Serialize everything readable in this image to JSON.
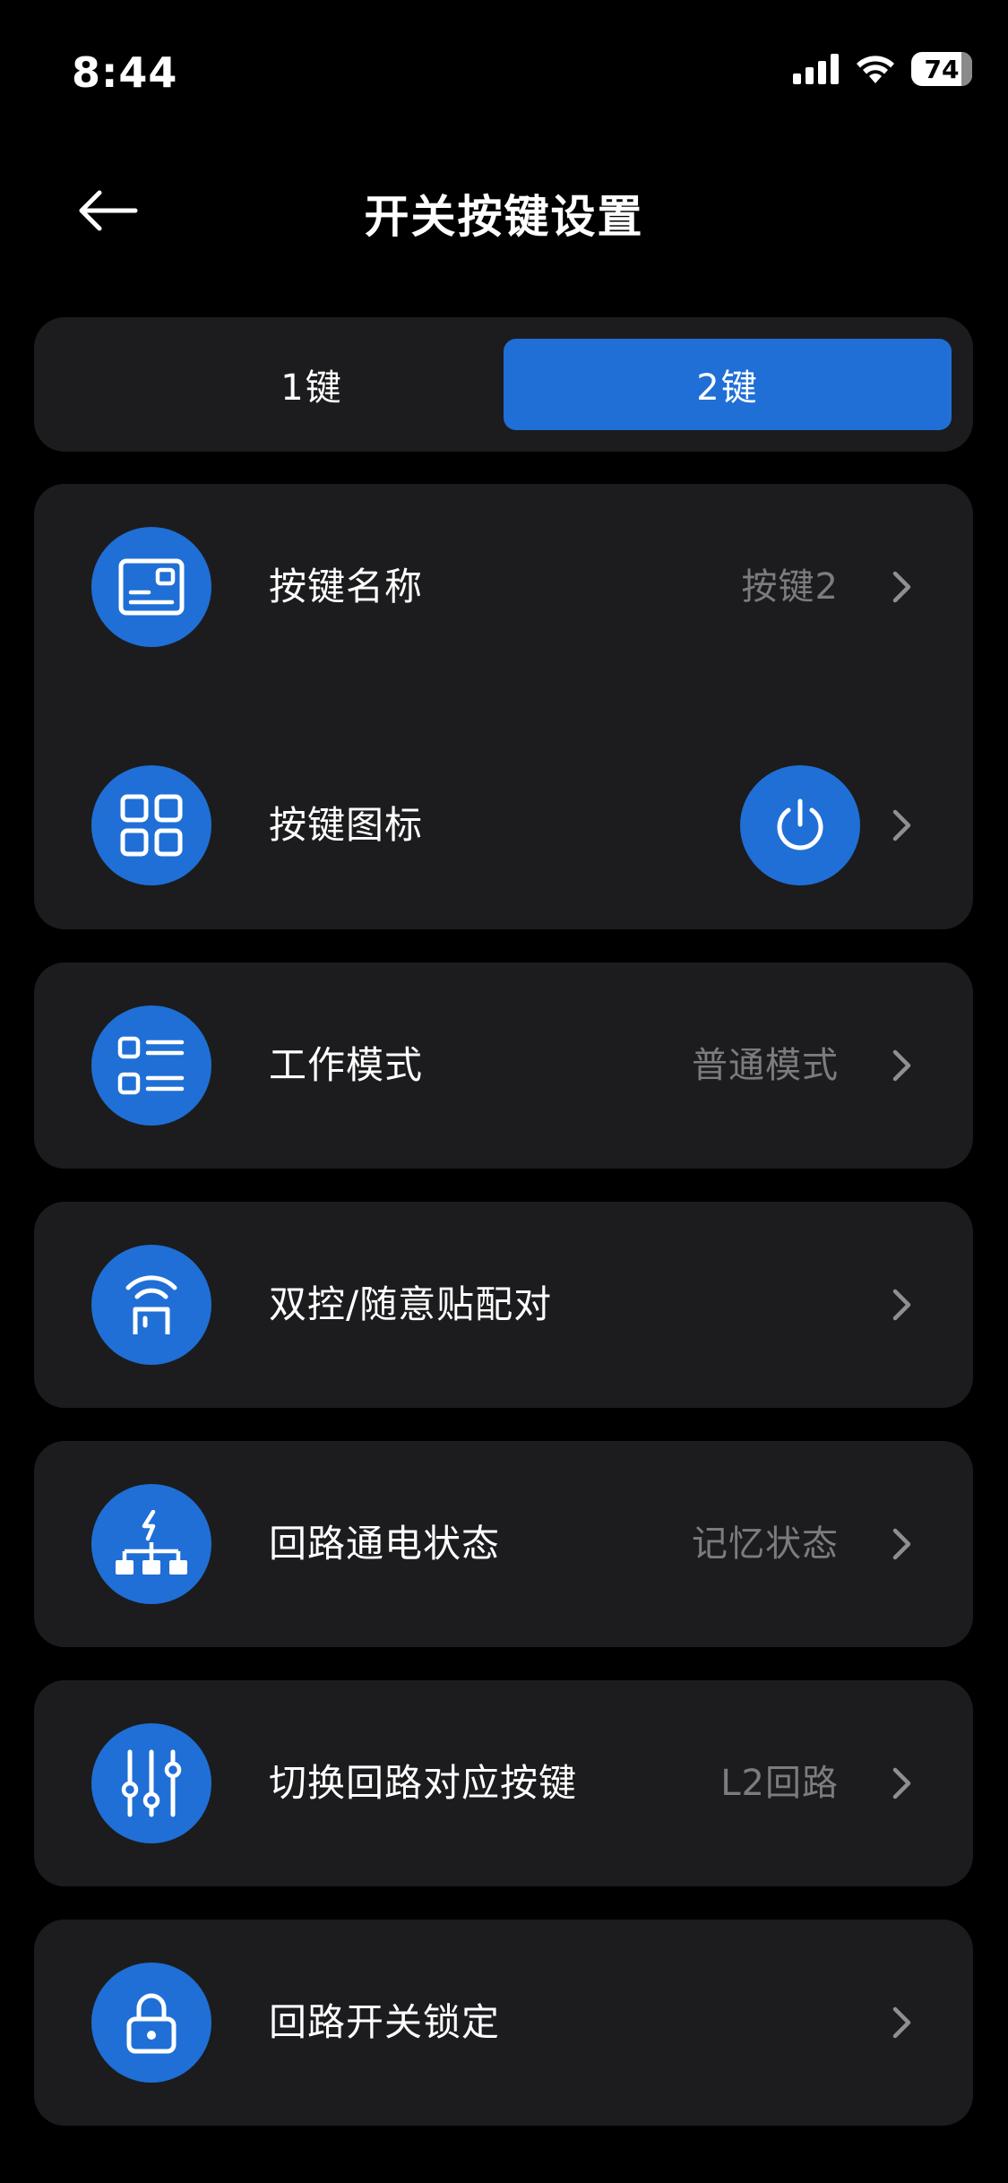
{
  "status": {
    "time": "8:44",
    "battery": "74"
  },
  "header": {
    "title": "开关按键设置"
  },
  "tabs": [
    {
      "label": "1键",
      "active": false
    },
    {
      "label": "2键",
      "active": true
    }
  ],
  "settings": {
    "key_name": {
      "label": "按键名称",
      "value": "按键2",
      "icon": "card-icon"
    },
    "key_icon": {
      "label": "按键图标",
      "icon": "grid-icon",
      "preview_icon": "power-icon"
    },
    "work_mode": {
      "label": "工作模式",
      "value": "普通模式",
      "icon": "list-icon"
    },
    "pairing": {
      "label": "双控/随意贴配对",
      "icon": "wireless-door-icon"
    },
    "power_state": {
      "label": "回路通电状态",
      "value": "记忆状态",
      "icon": "power-network-icon"
    },
    "switch_circuit": {
      "label": "切换回路对应按键",
      "value": "L2回路",
      "icon": "sliders-icon"
    },
    "lock": {
      "label": "回路开关锁定",
      "icon": "lock-icon"
    }
  },
  "colors": {
    "accent": "#1f6fd6",
    "card_bg": "#1c1c1e",
    "background": "#000000",
    "secondary_text": "#7c7c80"
  }
}
